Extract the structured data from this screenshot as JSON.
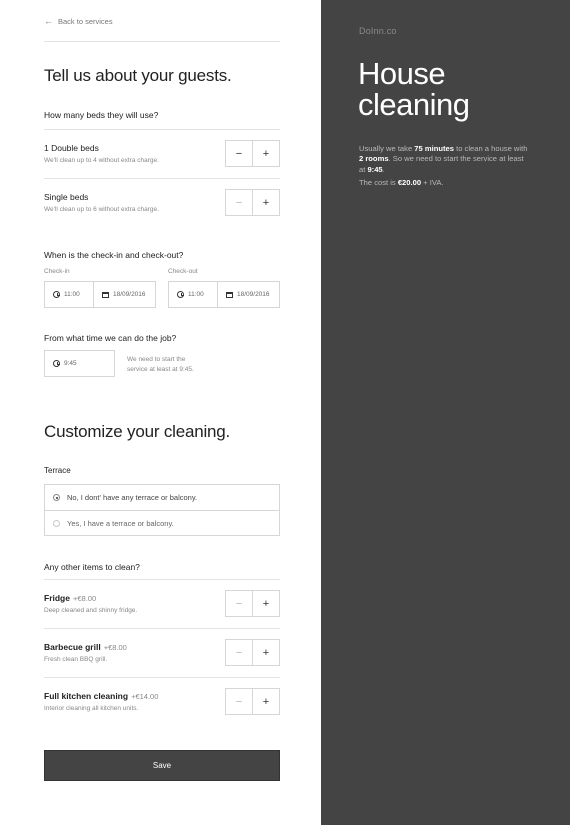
{
  "nav": {
    "back_label": "Back to services"
  },
  "guests": {
    "heading": "Tell us about your guests.",
    "beds_question": "How many beds they will use?",
    "double_beds": {
      "title": "1 Double beds",
      "desc": "We'll clean up to 4 without extra charge."
    },
    "single_beds": {
      "title": "Single beds",
      "desc": "We'll clean up to 6 without extra charge."
    },
    "checkin_question": "When is the check-in and check-out?",
    "checkin": {
      "label": "Check-in",
      "time": "11:00",
      "date": "18/09/2016"
    },
    "checkout": {
      "label": "Check-out",
      "time": "11:00",
      "date": "18/09/2016"
    },
    "job_time_question": "From what time we can do the job?",
    "job_time": "9:45",
    "job_time_hint_line1": "We need to start the",
    "job_time_hint_line2": "service at least at 9:45."
  },
  "customize": {
    "heading": "Customize your cleaning.",
    "terrace_label": "Terrace",
    "terrace_options": [
      {
        "label": "No, I dont' have any terrace or balcony.",
        "selected": true
      },
      {
        "label": "Yes, I have a terrace or balcony.",
        "selected": false
      }
    ],
    "other_items_question": "Any other items to clean?",
    "items": [
      {
        "title": "Fridge",
        "price": "+€8.00",
        "desc": "Deep cleaned and shinny fridge."
      },
      {
        "title": "Barbecue grill",
        "price": "+€8.00",
        "desc": "Fresh clean BBQ grill."
      },
      {
        "title": "Full kitchen cleaning",
        "price": "+€14.00",
        "desc": "Interior cleaning all kitchen units."
      }
    ],
    "save_label": "Save"
  },
  "summary": {
    "brand": "DoInn.co",
    "title_line1": "House",
    "title_line2": "cleaning",
    "info_1": "Usually we take ",
    "info_minutes": "75 minutes",
    "info_2": " to clean a house with ",
    "info_rooms": "2 rooms",
    "info_3": ". So we need to start the service at least at ",
    "info_time": "9:45",
    "info_4": ".",
    "cost_prefix": "The cost is ",
    "cost_value": "€20.00",
    "cost_suffix": " + IVA."
  },
  "icons": {
    "back": "arrow-left-icon",
    "minus": "minus-icon",
    "plus": "plus-icon",
    "clock": "clock-icon",
    "calendar": "calendar-icon",
    "radio": "radio-icon"
  },
  "colors": {
    "panel_bg": "#444444",
    "save_bg": "#444444",
    "border": "#d6d6d6"
  },
  "stepper_symbols": {
    "minus": "−",
    "plus": "+"
  }
}
